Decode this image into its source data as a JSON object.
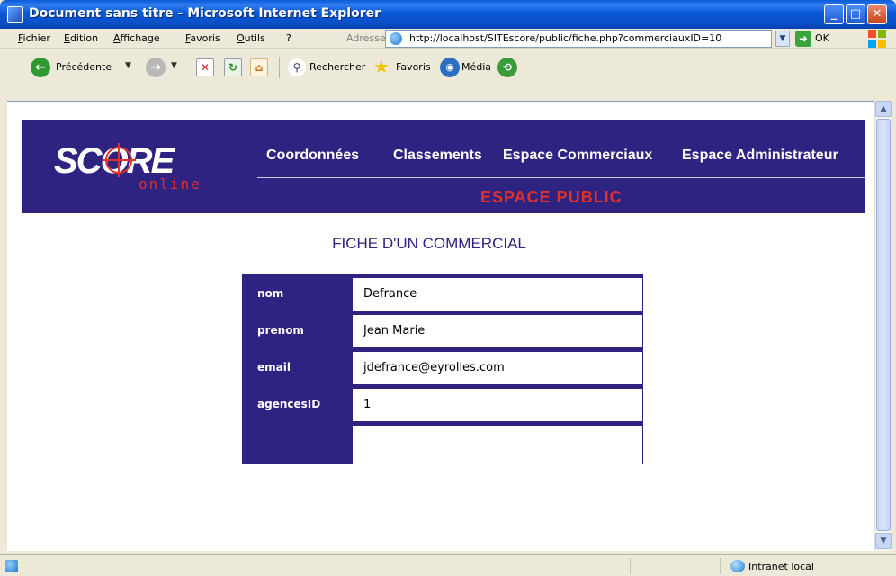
{
  "window": {
    "title": "Document sans titre - Microsoft Internet Explorer"
  },
  "menubar": {
    "items": [
      "Fichier",
      "Edition",
      "Affichage",
      "Favoris",
      "Outils",
      "?"
    ],
    "address_label": "Adresse",
    "address_value": "http://localhost/SITEscore/public/fiche.php?commerciauxID=10",
    "go_label": "OK"
  },
  "toolbar": {
    "back_label": "Précédente",
    "search_label": "Rechercher",
    "favorites_label": "Favoris",
    "media_label": "Média"
  },
  "page": {
    "logo": {
      "text": "SCORE",
      "subtext": "online"
    },
    "nav": [
      "Coordonnées",
      "Classements",
      "Espace Commerciaux",
      "Espace Administrateur"
    ],
    "section": "ESPACE PUBLIC",
    "title": "FICHE D'UN COMMERCIAL",
    "fiche": [
      {
        "label": "nom",
        "value": "Defrance"
      },
      {
        "label": "prenom",
        "value": "Jean Marie"
      },
      {
        "label": "email",
        "value": "jdefrance@eyrolles.com"
      },
      {
        "label": "agencesID",
        "value": "1"
      },
      {
        "label": "",
        "value": ""
      }
    ],
    "colors": {
      "banner": "#2e2380",
      "accent": "#e0302a"
    }
  },
  "statusbar": {
    "zone": "Intranet local"
  }
}
